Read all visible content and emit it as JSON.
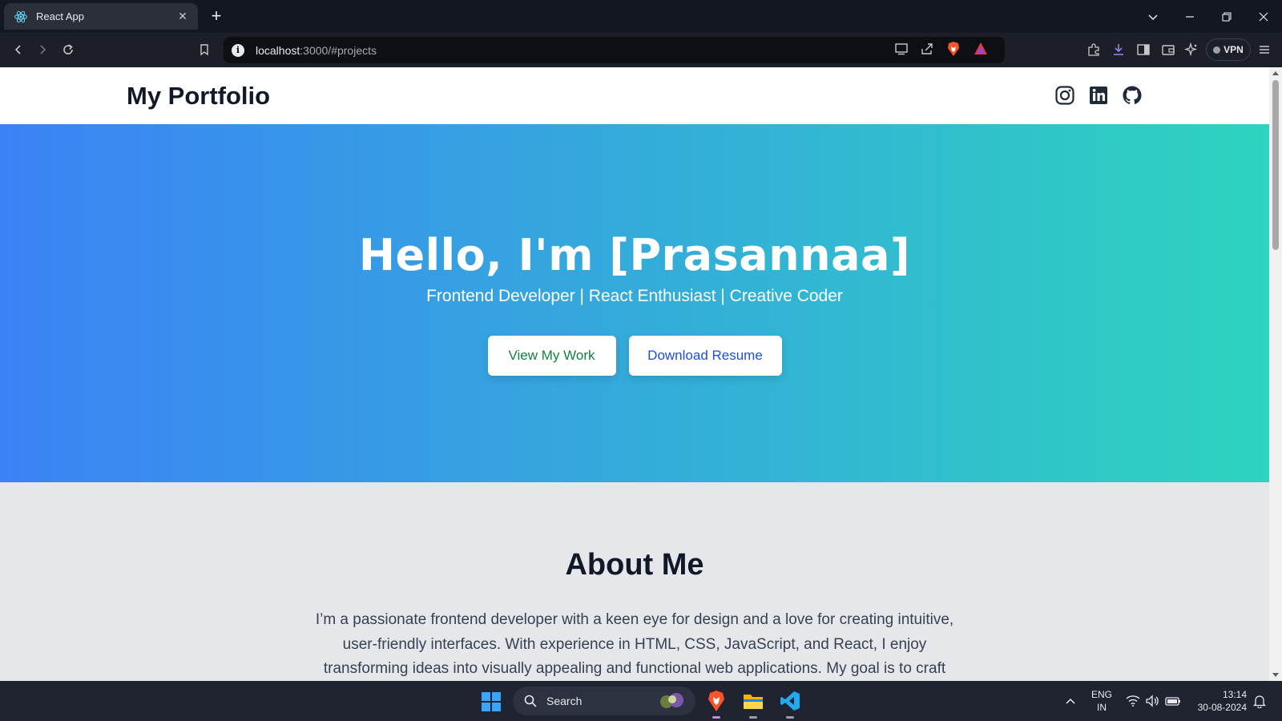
{
  "browser": {
    "tab_title": "React App",
    "url_host": "localhost",
    "url_rest": ":3000/#projects",
    "vpn_label": "VPN"
  },
  "site": {
    "title": "My Portfolio",
    "socials": [
      "instagram-icon",
      "linkedin-icon",
      "github-icon"
    ]
  },
  "hero": {
    "heading": "Hello, I'm [Prasannaa]",
    "tagline": "Frontend Developer | React Enthusiast | Creative Coder",
    "primary_button": "View My Work",
    "secondary_button": "Download Resume",
    "gradient_start": "#3b82f6",
    "gradient_end": "#2dd4bf"
  },
  "about": {
    "heading": "About Me",
    "text": "I’m a passionate frontend developer with a keen eye for design and a love for creating intuitive, user-friendly interfaces. With experience in HTML, CSS, JavaScript, and React, I enjoy transforming ideas into visually appealing and functional web applications. My goal is to craft"
  },
  "taskbar": {
    "search_label": "Search",
    "lang_line1": "ENG",
    "lang_line2": "IN",
    "time": "13:14",
    "date": "30-08-2024"
  }
}
